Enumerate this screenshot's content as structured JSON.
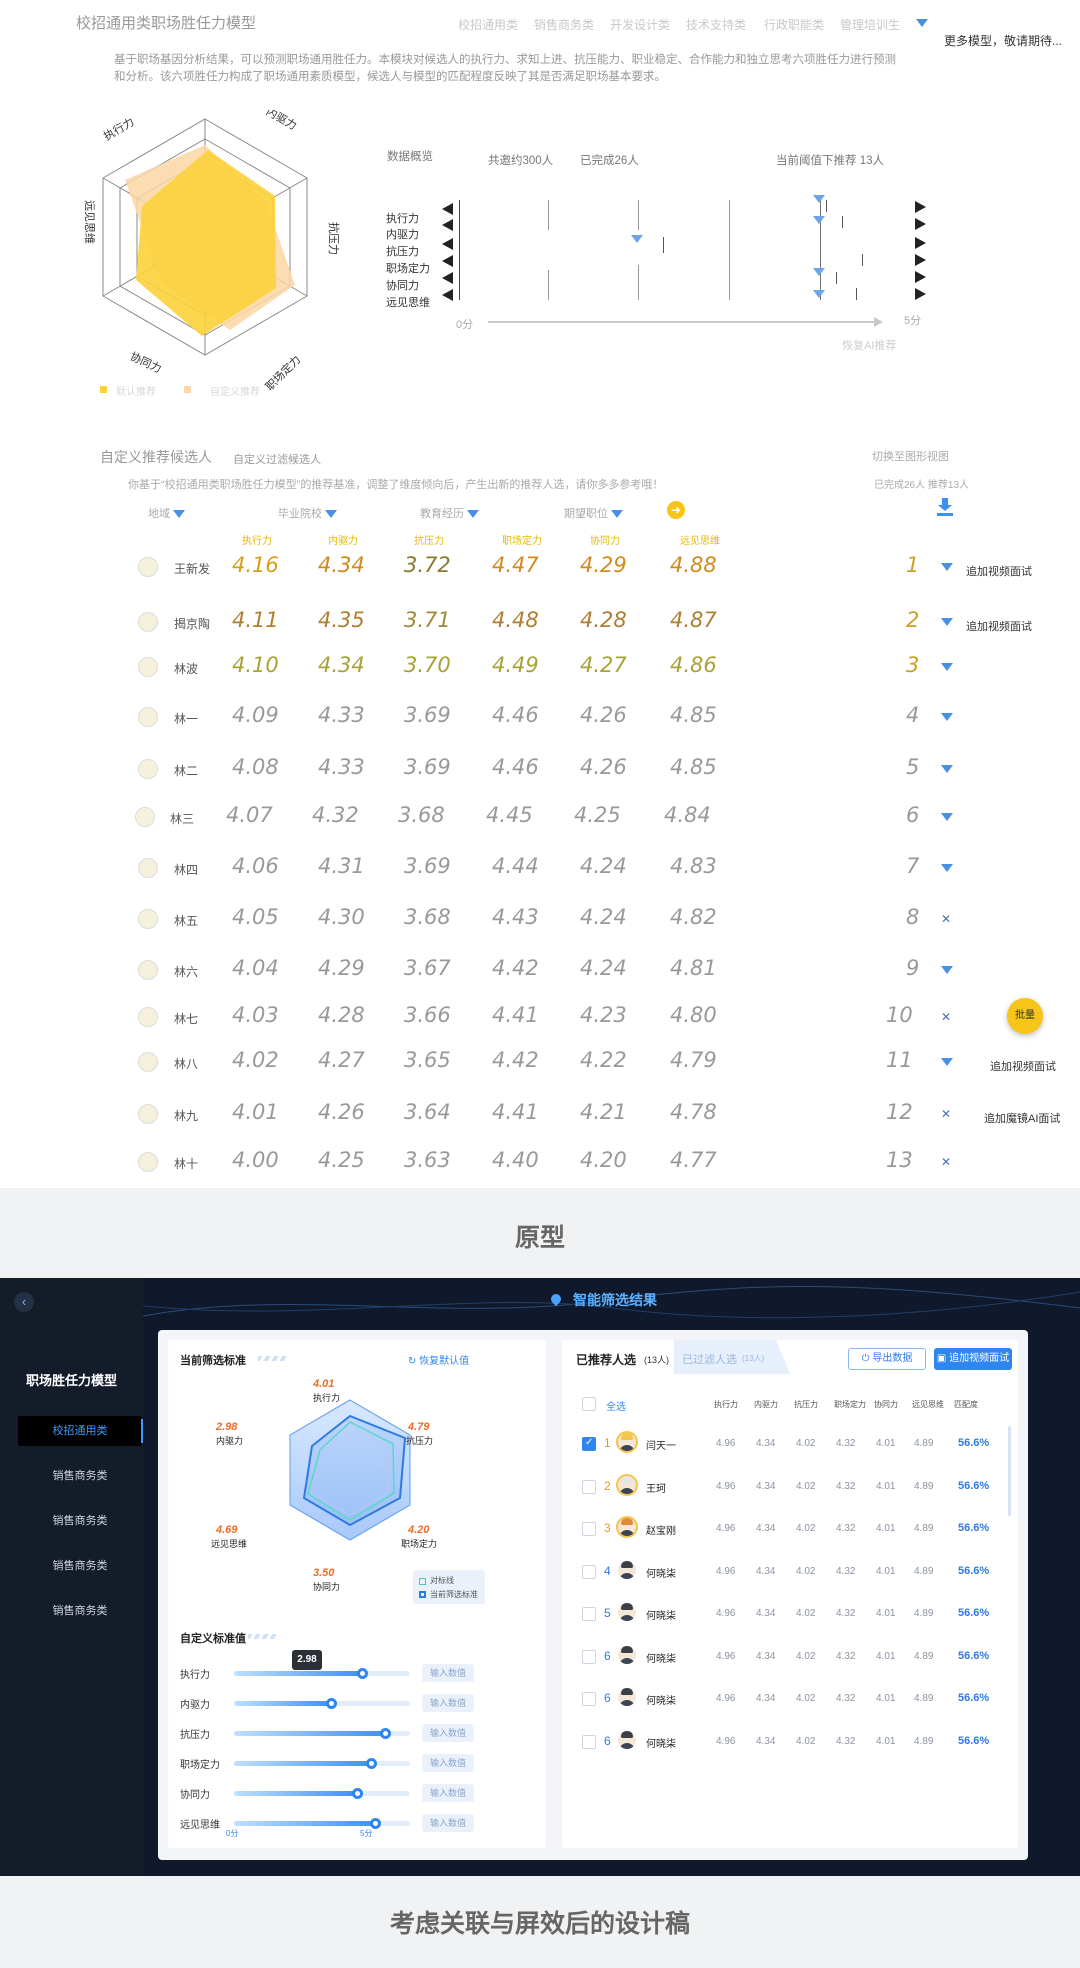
{
  "prototype": {
    "title": "校招通用类职场胜任力模型",
    "tabs": [
      "校招通用类",
      "销售商务类",
      "开发设计类",
      "技术支持类",
      "行政职能类",
      "管理培训生"
    ],
    "more": "更多模型，敬请期待...",
    "description": "基于职场基因分析结果，可以预测职场通用胜任力。本模块对候选人的执行力、求知上进、抗压能力、职业稳定、合作能力和独立思考六项胜任力进行预测和分析。该六项胜任力构成了职场通用素质模型，候选人与模型的匹配程度反映了其是否满足职场基本要求。",
    "radar": {
      "axes": [
        "执行力",
        "内驱力",
        "抗压力",
        "职场定力",
        "协同力",
        "远见思维"
      ],
      "legend": [
        "默认推荐",
        "自定义推荐"
      ]
    },
    "overview": {
      "label": "数据概览",
      "invited": "共邀约300人",
      "completed": "已完成26人",
      "recommend": "当前阈值下推荐 13人",
      "dims": [
        "执行力",
        "内驱力",
        "抗压力",
        "职场定力",
        "协同力",
        "远见思维"
      ],
      "axis_min": "0分",
      "axis_max": "5分",
      "reset": "恢复AI推荐"
    },
    "custom": {
      "title": "自定义推荐候选人",
      "subtitle": "自定义过滤候选人",
      "note": "你基于“校招通用类职场胜任力模型”的推荐基准，调整了维度倾向后，产生出新的推荐人选，请你多多参考哦！",
      "switch_view": "切换至图形视图",
      "stats": "已完成26人  推荐13人"
    },
    "filters": [
      "地域",
      "毕业院校",
      "教育经历",
      "期望职位"
    ],
    "columns": [
      "执行力",
      "内驱力",
      "抗压力",
      "职场定力",
      "协同力",
      "远见思维"
    ],
    "rows": [
      {
        "name": "王新发",
        "scores": [
          "4.16",
          "4.34",
          "3.72",
          "4.47",
          "4.29",
          "4.88"
        ],
        "rank": "1",
        "action": "追加视频面试"
      },
      {
        "name": "揭京陶",
        "scores": [
          "4.11",
          "4.35",
          "3.71",
          "4.48",
          "4.28",
          "4.87"
        ],
        "rank": "2",
        "action": "追加视频面试"
      },
      {
        "name": "林波",
        "scores": [
          "4.10",
          "4.34",
          "3.70",
          "4.49",
          "4.27",
          "4.86"
        ],
        "rank": "3",
        "action": ""
      },
      {
        "name": "林一",
        "scores": [
          "4.09",
          "4.33",
          "3.69",
          "4.46",
          "4.26",
          "4.85"
        ],
        "rank": "4",
        "action": ""
      },
      {
        "name": "林二",
        "scores": [
          "4.08",
          "4.33",
          "3.69",
          "4.46",
          "4.26",
          "4.85"
        ],
        "rank": "5",
        "action": ""
      },
      {
        "name": "林三",
        "scores": [
          "4.07",
          "4.32",
          "3.68",
          "4.45",
          "4.25",
          "4.84"
        ],
        "rank": "6",
        "action": ""
      },
      {
        "name": "林四",
        "scores": [
          "4.06",
          "4.31",
          "3.69",
          "4.44",
          "4.24",
          "4.83"
        ],
        "rank": "7",
        "action": ""
      },
      {
        "name": "林五",
        "scores": [
          "4.05",
          "4.30",
          "3.68",
          "4.43",
          "4.24",
          "4.82"
        ],
        "rank": "8",
        "action": ""
      },
      {
        "name": "林六",
        "scores": [
          "4.04",
          "4.29",
          "3.67",
          "4.42",
          "4.24",
          "4.81"
        ],
        "rank": "9",
        "action": ""
      },
      {
        "name": "林七",
        "scores": [
          "4.03",
          "4.28",
          "3.66",
          "4.41",
          "4.23",
          "4.80"
        ],
        "rank": "10",
        "action": ""
      },
      {
        "name": "林八",
        "scores": [
          "4.02",
          "4.27",
          "3.65",
          "4.42",
          "4.22",
          "4.79"
        ],
        "rank": "11",
        "action": "追加视频面试"
      },
      {
        "name": "林九",
        "scores": [
          "4.01",
          "4.26",
          "3.64",
          "4.41",
          "4.21",
          "4.78"
        ],
        "rank": "12",
        "action": "追加魔镜AI面试"
      },
      {
        "name": "林十",
        "scores": [
          "4.00",
          "4.25",
          "3.63",
          "4.40",
          "4.20",
          "4.77"
        ],
        "rank": "13",
        "action": ""
      }
    ],
    "batch": "批量"
  },
  "caption1": "原型",
  "design": {
    "header": "智能筛选结果",
    "sidebar_title": "职场胜任力模型",
    "sidebar_items": [
      "校招通用类",
      "销售商务类",
      "销售商务类",
      "销售商务类",
      "销售商务类"
    ],
    "current_standard": "当前筛选标准",
    "reset": "恢复默认值",
    "radar": [
      {
        "label": "执行力",
        "value": "4.01"
      },
      {
        "label": "抗压力",
        "value": "4.79"
      },
      {
        "label": "职场定力",
        "value": "4.20"
      },
      {
        "label": "协同力",
        "value": "3.50"
      },
      {
        "label": "远见思维",
        "value": "4.69"
      },
      {
        "label": "内驱力",
        "value": "2.98"
      }
    ],
    "legend": [
      "对标线",
      "当前筛选标准"
    ],
    "custom_title": "自定义标准值",
    "sliders": [
      {
        "label": "执行力",
        "value": 0.73
      },
      {
        "label": "内驱力",
        "value": 0.55
      },
      {
        "label": "抗压力",
        "value": 0.86
      },
      {
        "label": "职场定力",
        "value": 0.78
      },
      {
        "label": "协同力",
        "value": 0.7
      },
      {
        "label": "远见思维",
        "value": 0.8
      }
    ],
    "tooltip": "2.98",
    "input_label": "输入数值",
    "axis_min": "0分",
    "axis_max": "5分",
    "tab_recommended": "已推荐人选",
    "tab_recommended_count": "(13人)",
    "tab_filtered": "已过滤人选",
    "tab_filtered_count": "(13人)",
    "export": "导出数据",
    "add_video": "追加视频面试",
    "select_all": "全选",
    "columns": [
      "执行力",
      "内驱力",
      "抗压力",
      "职场定力",
      "协同力",
      "远见思维",
      "匹配度"
    ],
    "rows": [
      {
        "rank": "1",
        "name": "闫天一",
        "scores": [
          "4.96",
          "4.34",
          "4.02",
          "4.32",
          "4.01",
          "4.89"
        ],
        "match": "56.6%",
        "checked": true
      },
      {
        "rank": "2",
        "name": "王珂",
        "scores": [
          "4.96",
          "4.34",
          "4.02",
          "4.32",
          "4.01",
          "4.89"
        ],
        "match": "56.6%",
        "checked": false
      },
      {
        "rank": "3",
        "name": "赵宝刚",
        "scores": [
          "4.96",
          "4.34",
          "4.02",
          "4.32",
          "4.01",
          "4.89"
        ],
        "match": "56.6%",
        "checked": false
      },
      {
        "rank": "4",
        "name": "何晓柒",
        "scores": [
          "4.96",
          "4.34",
          "4.02",
          "4.32",
          "4.01",
          "4.89"
        ],
        "match": "56.6%",
        "checked": false
      },
      {
        "rank": "5",
        "name": "何晓柒",
        "scores": [
          "4.96",
          "4.34",
          "4.02",
          "4.32",
          "4.01",
          "4.89"
        ],
        "match": "56.6%",
        "checked": false
      },
      {
        "rank": "6",
        "name": "何晓柒",
        "scores": [
          "4.96",
          "4.34",
          "4.02",
          "4.32",
          "4.01",
          "4.89"
        ],
        "match": "56.6%",
        "checked": false
      },
      {
        "rank": "6",
        "name": "何晓柒",
        "scores": [
          "4.96",
          "4.34",
          "4.02",
          "4.32",
          "4.01",
          "4.89"
        ],
        "match": "56.6%",
        "checked": false
      },
      {
        "rank": "6",
        "name": "何晓柒",
        "scores": [
          "4.96",
          "4.34",
          "4.02",
          "4.32",
          "4.01",
          "4.89"
        ],
        "match": "56.6%",
        "checked": false
      }
    ]
  },
  "caption2": "考虑关联与屏效后的设计稿"
}
